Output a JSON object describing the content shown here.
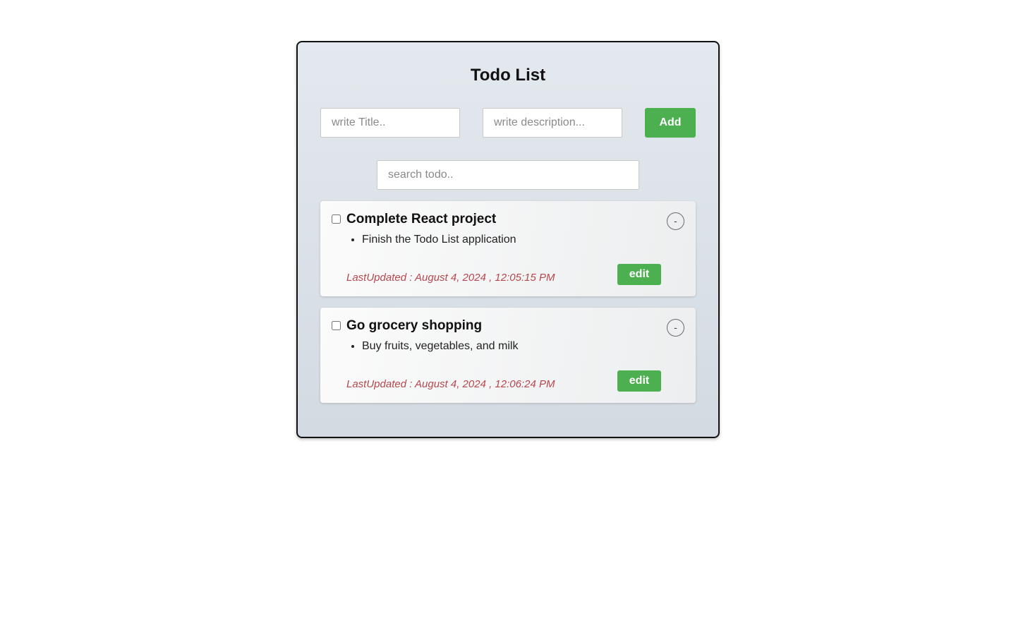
{
  "app": {
    "title": "Todo List"
  },
  "form": {
    "title_placeholder": "write Title..",
    "title_value": "",
    "description_placeholder": "write description...",
    "description_value": "",
    "add_label": "Add"
  },
  "search": {
    "placeholder": "search todo..",
    "value": ""
  },
  "todos": [
    {
      "title": "Complete React project",
      "description": "Finish the Todo List application",
      "last_updated": "LastUpdated : August 4, 2024 , 12:05:15 PM",
      "completed": false,
      "remove_label": "-",
      "edit_label": "edit"
    },
    {
      "title": "Go grocery shopping",
      "description": "Buy fruits, vegetables, and milk",
      "last_updated": "LastUpdated : August 4, 2024 , 12:06:24 PM",
      "completed": false,
      "remove_label": "-",
      "edit_label": "edit"
    }
  ],
  "colors": {
    "accent": "#4caf50",
    "timestamp": "#b5474d"
  }
}
